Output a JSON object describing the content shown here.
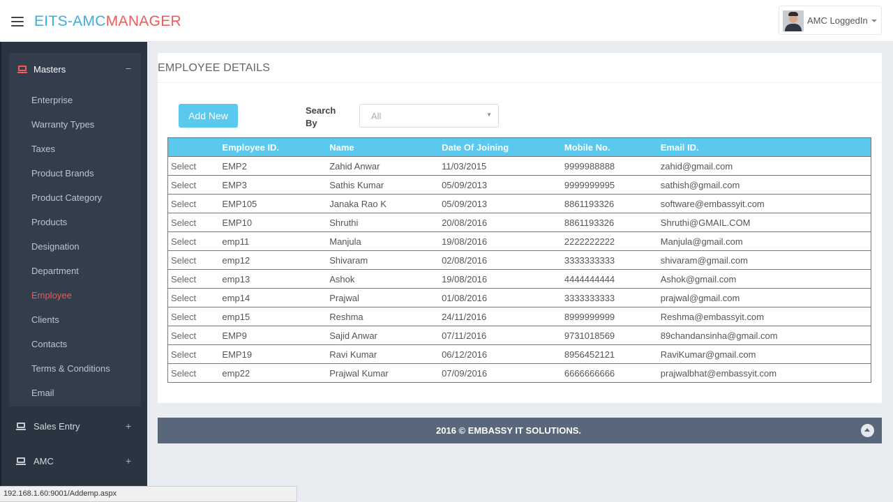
{
  "header": {
    "brand_part1": "EITS-AMC",
    "brand_part2": "MANAGER",
    "user_label": "AMC LoggedIn"
  },
  "sidebar": {
    "masters": {
      "label": "Masters",
      "toggle": "−",
      "items": [
        "Enterprise",
        "Warranty Types",
        "Taxes",
        "Product Brands",
        "Product Category",
        "Products",
        "Designation",
        "Department",
        "Employee",
        "Clients",
        "Contacts",
        "Terms & Conditions",
        "Email"
      ],
      "active_item": "Employee"
    },
    "sales_entry": {
      "label": "Sales Entry",
      "toggle": "+"
    },
    "amc": {
      "label": "AMC",
      "toggle": "+"
    }
  },
  "main": {
    "title": "EMPLOYEE DETAILS",
    "add_button": "Add New",
    "search_by_label": "Search By",
    "search_select_value": "All",
    "table": {
      "headers": [
        "",
        "Employee ID.",
        "Name",
        "Date Of Joining",
        "Mobile No.",
        "Email ID."
      ],
      "rows": [
        [
          "Select",
          "EMP2",
          "Zahid Anwar",
          "11/03/2015",
          "9999988888",
          "zahid@gmail.com"
        ],
        [
          "Select",
          "EMP3",
          "Sathis Kumar",
          "05/09/2013",
          "9999999995",
          "sathish@gmail.com"
        ],
        [
          "Select",
          "EMP105",
          "Janaka Rao K",
          "05/09/2013",
          "8861193326",
          "software@embassyit.com"
        ],
        [
          "Select",
          "EMP10",
          "Shruthi",
          "20/08/2016",
          "8861193326",
          "Shruthi@GMAIL.COM"
        ],
        [
          "Select",
          "emp11",
          "Manjula",
          "19/08/2016",
          "2222222222",
          "Manjula@gmail.com"
        ],
        [
          "Select",
          "emp12",
          "Shivaram",
          "02/08/2016",
          "3333333333",
          "shivaram@gmail.com"
        ],
        [
          "Select",
          "emp13",
          "Ashok",
          "19/08/2016",
          "4444444444",
          "Ashok@gmail.com"
        ],
        [
          "Select",
          "emp14",
          "Prajwal",
          "01/08/2016",
          "3333333333",
          "prajwal@gmail.com"
        ],
        [
          "Select",
          "emp15",
          "Reshma",
          "24/11/2016",
          "8999999999",
          "Reshma@embassyit.com"
        ],
        [
          "Select",
          "EMP9",
          "Sajid Anwar",
          "07/11/2016",
          "9731018569",
          "89chandansinha@gmail.com"
        ],
        [
          "Select",
          "EMP19",
          "Ravi Kumar",
          "06/12/2016",
          "8956452121",
          "RaviKumar@gmail.com"
        ],
        [
          "Select",
          "emp22",
          "Prajwal Kumar",
          "07/09/2016",
          "6666666666",
          "prajwalbhat@embassyit.com"
        ]
      ]
    }
  },
  "footer": {
    "text": "2016 © EMBASSY IT SOLUTIONS."
  },
  "statusbar": {
    "url": "192.168.1.60:9001/Addemp.aspx"
  },
  "colors": {
    "accent": "#5bc8ee",
    "brand_blue": "#3aaee0",
    "brand_red": "#f05a5a",
    "sidebar_bg": "#2b3441",
    "footer_bg": "#59677a"
  },
  "icons": [
    "menu-icon",
    "laptop-icon",
    "chevron-down-icon",
    "arrow-up-icon"
  ]
}
